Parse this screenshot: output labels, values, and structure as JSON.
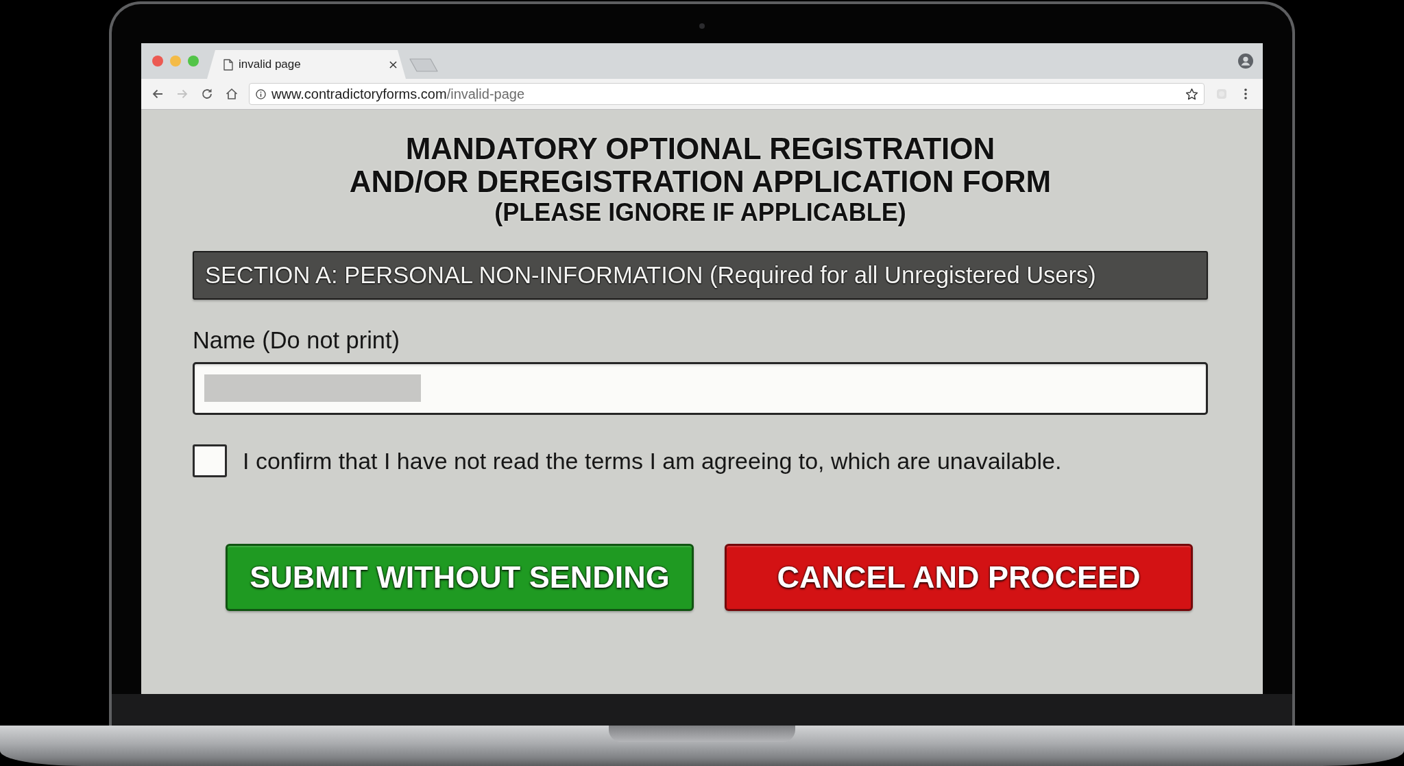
{
  "browser": {
    "tabs": [
      {
        "title": "invalid page",
        "selected": true
      }
    ],
    "url": "www.contradictoryforms.com/invalid-page"
  },
  "form": {
    "title": "MANDATORY OPTIONAL REGISTRATION\nAND/OR DEREGISTRATION APPLICATION FORM",
    "subtitle": "(PLEASE IGNORE IF APPLICABLE)",
    "section_header": "SECTION A: PERSONAL NON-INFORMATION (Required for all Unregistered Users)",
    "name_field": {
      "label": "Name (Do not print)",
      "value_obscured": true
    },
    "agreement": {
      "label": "I confirm that I have not read the terms I am agreeing to, which are unavailable.",
      "checked": false
    },
    "buttons": [
      {
        "label": "SUBMIT WITHOUT SENDING",
        "color": "#1f9a22"
      },
      {
        "label": "CANCEL AND PROCEED",
        "color": "#d31214"
      }
    ]
  }
}
